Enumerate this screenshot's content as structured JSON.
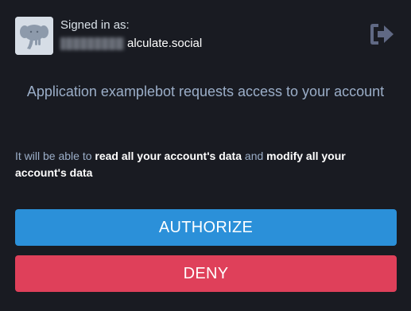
{
  "account": {
    "signed_in_label": "Signed in as:",
    "account_domain": "alculate.social"
  },
  "prompt": {
    "text": "Application examplebot requests access to your account"
  },
  "permissions": {
    "intro": "It will be able to ",
    "read": "read all your account's data",
    "joiner": " and ",
    "modify": "modify all your account's data"
  },
  "actions": {
    "authorize_label": "AUTHORIZE",
    "deny_label": "DENY"
  },
  "colors": {
    "background": "#191b22",
    "authorize": "#2b90d9",
    "deny": "#df405a",
    "secondary_text": "#9baec8"
  },
  "icons": {
    "avatar": "mastodon-elephant-icon",
    "logout": "logout-icon"
  }
}
